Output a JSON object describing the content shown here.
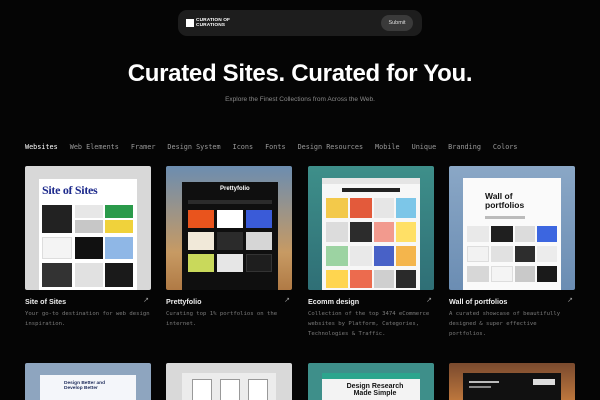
{
  "topbar": {
    "logo_text": "CURATION OF CURATIONS",
    "submit_label": "Submit"
  },
  "hero": {
    "title": "Curated Sites. Curated for You.",
    "subtitle": "Explore the Finest Collections from Across the Web."
  },
  "categories": [
    "Websites",
    "Web Elements",
    "Framer",
    "Design System",
    "Icons",
    "Fonts",
    "Design Resources",
    "Mobile",
    "Unique",
    "Branding",
    "Colors"
  ],
  "cards": [
    {
      "title": "Site of Sites",
      "desc": "Your go-to destination for web design inspiration.",
      "thumb_label": "Site of Sites"
    },
    {
      "title": "Prettyfolio",
      "desc": "Curating top 1% portfolios on the internet.",
      "thumb_label": "Prettyfolio"
    },
    {
      "title": "Ecomm design",
      "desc": "Collection of the top 3474 eCommerce websites by Platform, Categories, Technologies & Traffic.",
      "thumb_label": ""
    },
    {
      "title": "Wall of portfolios",
      "desc": "A curated showcase of beautifully designed & super effective portfolios.",
      "thumb_label": "Wall of portfolios"
    }
  ],
  "row2": [
    {
      "thumb_label": "Design Better and Develop Better"
    },
    {
      "thumb_label": ""
    },
    {
      "thumb_label": "Design Research Made Simple"
    },
    {
      "thumb_label": ""
    }
  ],
  "colors": {
    "accent_orange": "#e9541d",
    "page_bg": "#050505"
  }
}
